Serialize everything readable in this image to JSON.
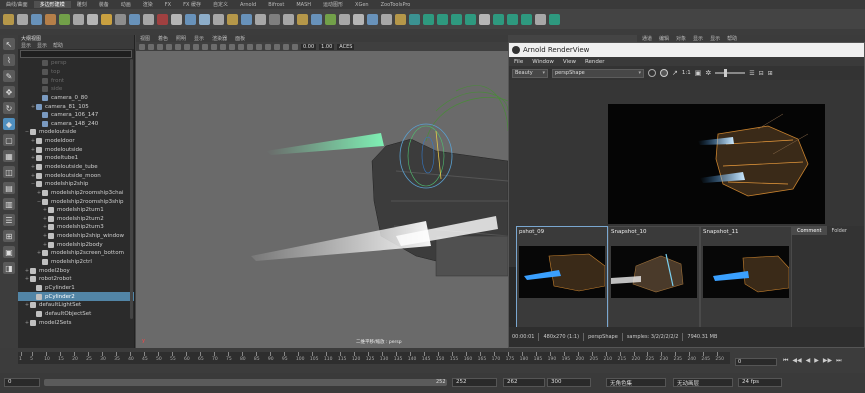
{
  "shelf": {
    "tabs": [
      "曲线/曲面",
      "多边形建模",
      "雕刻",
      "装备",
      "动画",
      "渲染",
      "FX",
      "FX 缓存",
      "自定义",
      "Arnold",
      "Bifrost",
      "MASH",
      "运动图形",
      "XGen",
      "ZooToolsPro"
    ],
    "active_tab": "多边形建模"
  },
  "outliner": {
    "title": "大纲视图",
    "menu": [
      "显示",
      "显示",
      "帮助"
    ],
    "items": [
      {
        "label": "persp",
        "dim": true,
        "indent": 3
      },
      {
        "label": "top",
        "dim": true,
        "indent": 3
      },
      {
        "label": "front",
        "dim": true,
        "indent": 3
      },
      {
        "label": "side",
        "dim": true,
        "indent": 3
      },
      {
        "label": "camera_0_80",
        "indent": 3
      },
      {
        "label": "camera_81_105",
        "indent": 2,
        "exp": "+"
      },
      {
        "label": "camera_106_147",
        "indent": 3
      },
      {
        "label": "camera_148_240",
        "indent": 3
      },
      {
        "label": "modeloutside",
        "indent": 1,
        "exp": "−"
      },
      {
        "label": "modeldoor",
        "indent": 2,
        "exp": "+"
      },
      {
        "label": "modeloutside",
        "indent": 2,
        "exp": "+"
      },
      {
        "label": "modeltube1",
        "indent": 2,
        "exp": "+"
      },
      {
        "label": "modeloutside_tube",
        "indent": 2,
        "exp": "+"
      },
      {
        "label": "modeloutside_moon",
        "indent": 2,
        "exp": "+"
      },
      {
        "label": "modelship2ship",
        "indent": 2,
        "exp": "−"
      },
      {
        "label": "modelship2roomship3chai",
        "indent": 3,
        "exp": "+"
      },
      {
        "label": "modelship2roomship3ship",
        "indent": 3,
        "exp": "−"
      },
      {
        "label": "modelship2turn1",
        "indent": 4,
        "exp": "+"
      },
      {
        "label": "modelship2turn2",
        "indent": 4,
        "exp": "+"
      },
      {
        "label": "modelship2turn3",
        "indent": 4,
        "exp": "+"
      },
      {
        "label": "modelship2ship_window",
        "indent": 4,
        "exp": "+"
      },
      {
        "label": "modelship2body",
        "indent": 4,
        "exp": "+"
      },
      {
        "label": "modelship2screen_bottom",
        "indent": 3,
        "exp": "+"
      },
      {
        "label": "modelship2ctrl",
        "indent": 3
      },
      {
        "label": "model2boy",
        "indent": 1,
        "exp": "+"
      },
      {
        "label": "robot2robot",
        "indent": 1,
        "exp": "+"
      },
      {
        "label": "pCylinder1",
        "indent": 2
      },
      {
        "label": "pCylinder2",
        "indent": 2,
        "selected": true
      },
      {
        "label": "defaultLightSet",
        "indent": 1,
        "exp": "+"
      },
      {
        "label": "defaultObjectSet",
        "indent": 2
      },
      {
        "label": "model2Sets",
        "indent": 1,
        "exp": "+"
      }
    ]
  },
  "viewport": {
    "menu": [
      "视图",
      "着色",
      "照明",
      "显示",
      "渲染器",
      "面板"
    ],
    "exposure": "0.00",
    "gamma": "1.00",
    "colorspace": "ACES",
    "camera_label": "二维平移/缩放 : persp",
    "axis_label": "y"
  },
  "renderview": {
    "title": "Arnold RenderView",
    "menu": [
      "File",
      "Window",
      "View",
      "Render"
    ],
    "aov": "Beauty",
    "camera": "perspShape",
    "ratio": "1:1",
    "snapshots": [
      {
        "label": "pshot_09",
        "selected": true
      },
      {
        "label": "Snapshot_10"
      },
      {
        "label": "Snapshot_11"
      }
    ],
    "side_tabs": [
      "Comment",
      "Folder"
    ],
    "status": {
      "time": "00:00:01",
      "resolution": "480x270 (1:1)",
      "camera": "perspShape",
      "samples": "samples: 3/2/2/2/2/2",
      "memory": "7940.31 MB"
    }
  },
  "channel_menu": [
    "通道",
    "编辑",
    "对象",
    "显示",
    "显示",
    "帮助"
  ],
  "timeline": {
    "ticks": [
      1,
      5,
      10,
      15,
      20,
      25,
      30,
      35,
      40,
      45,
      50,
      55,
      60,
      65,
      70,
      75,
      80,
      85,
      90,
      95,
      100,
      105,
      110,
      115,
      120,
      125,
      130,
      135,
      140,
      145,
      150,
      155,
      160,
      165,
      170,
      175,
      180,
      185,
      190,
      195,
      200,
      205,
      210,
      215,
      220,
      225,
      230,
      235,
      240,
      245,
      250
    ],
    "current_frame": "0"
  },
  "range": {
    "start": "0",
    "playback_start": "0",
    "playback_end": "252",
    "range_end": "262",
    "anim_end": "300",
    "char_set": "无角色集",
    "anim_layer": "无动画层",
    "fps": "24 fps"
  },
  "colors": {
    "accent": "#5285a6",
    "beam_green": "#7ff0b4",
    "beam_white": "#f4f4f4",
    "beam_blue": "#3aa0ff"
  }
}
